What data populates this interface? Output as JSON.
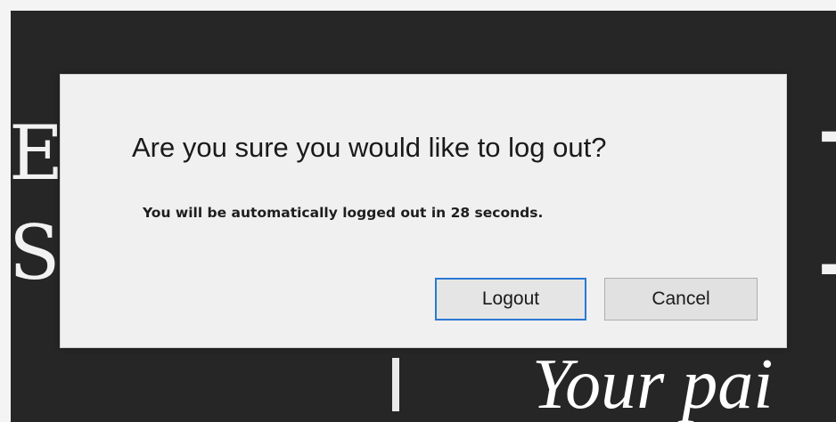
{
  "background": {
    "left_letters": [
      "EI",
      "SI"
    ],
    "right_letter": "E",
    "tagline": "Your pai"
  },
  "dialog": {
    "title": "Are you sure you would like to log out?",
    "message": "You will be automatically logged out in 28 seconds.",
    "buttons": {
      "logout_label": "Logout",
      "cancel_label": "Cancel"
    },
    "focus_color": "#2b78d4"
  }
}
